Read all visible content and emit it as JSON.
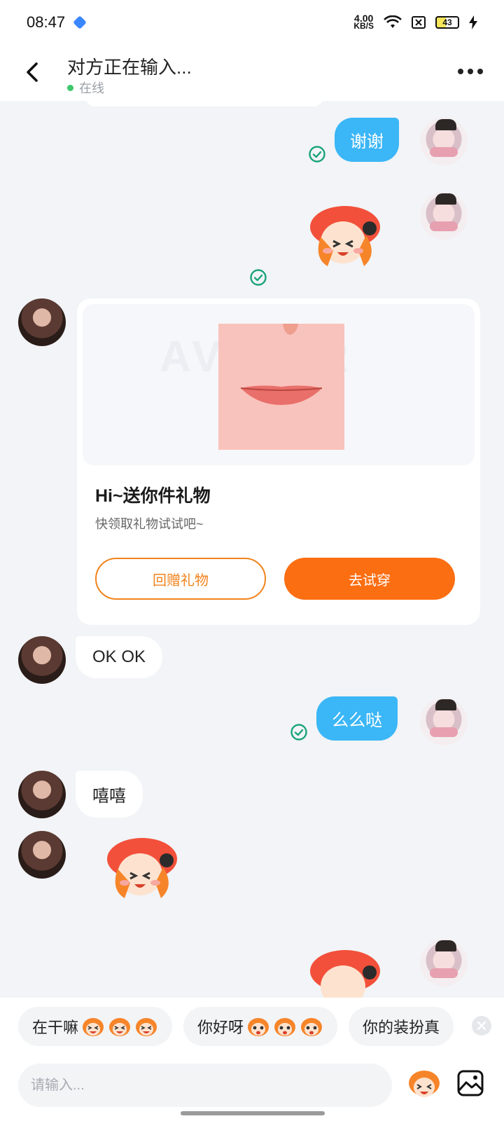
{
  "status_bar": {
    "time": "08:47",
    "net_speed": "4.00",
    "net_unit": "KB/S",
    "battery": "43",
    "icons": [
      "app-icon",
      "wifi-icon",
      "sim-off-icon",
      "battery-icon",
      "charging-icon"
    ]
  },
  "header": {
    "title": "对方正在输入...",
    "status": "在线",
    "back_icon": "chevron-left-icon",
    "more_icon": "more-horizontal-icon"
  },
  "messages": [
    {
      "from": "me",
      "type": "text",
      "text": "谢谢",
      "status": "read"
    },
    {
      "from": "me",
      "type": "sticker",
      "sticker": "orange-hat-girl-sticker",
      "status": "read"
    },
    {
      "from": "other",
      "type": "gift_card",
      "title": "Hi~送你件礼物",
      "subtitle": "快领取礼物试试吧~",
      "watermark": "AVATAR",
      "buttons": {
        "return_gift": "回赠礼物",
        "try_on": "去试穿"
      }
    },
    {
      "from": "other",
      "type": "text",
      "text": "OK OK"
    },
    {
      "from": "me",
      "type": "text",
      "text": "么么哒",
      "status": "read"
    },
    {
      "from": "other",
      "type": "text",
      "text": "嘻嘻"
    },
    {
      "from": "other",
      "type": "sticker",
      "sticker": "orange-hat-girl-sticker"
    },
    {
      "from": "me",
      "type": "sticker",
      "sticker": "orange-hat-girl-sticker"
    }
  ],
  "quick_replies": [
    {
      "text": "在干嘛",
      "emoji": "laughing-face-icon"
    },
    {
      "text": "你好呀",
      "emoji": "shocked-face-icon"
    },
    {
      "text": "你的装扮真"
    }
  ],
  "input": {
    "placeholder": "请输入...",
    "emoji_button": "sticker-face-icon",
    "image_button": "image-icon"
  },
  "colors": {
    "accent_blue": "#3bb6f6",
    "accent_orange": "#fb6e12",
    "online_green": "#3cc76a",
    "read_check": "#1aa37a"
  }
}
